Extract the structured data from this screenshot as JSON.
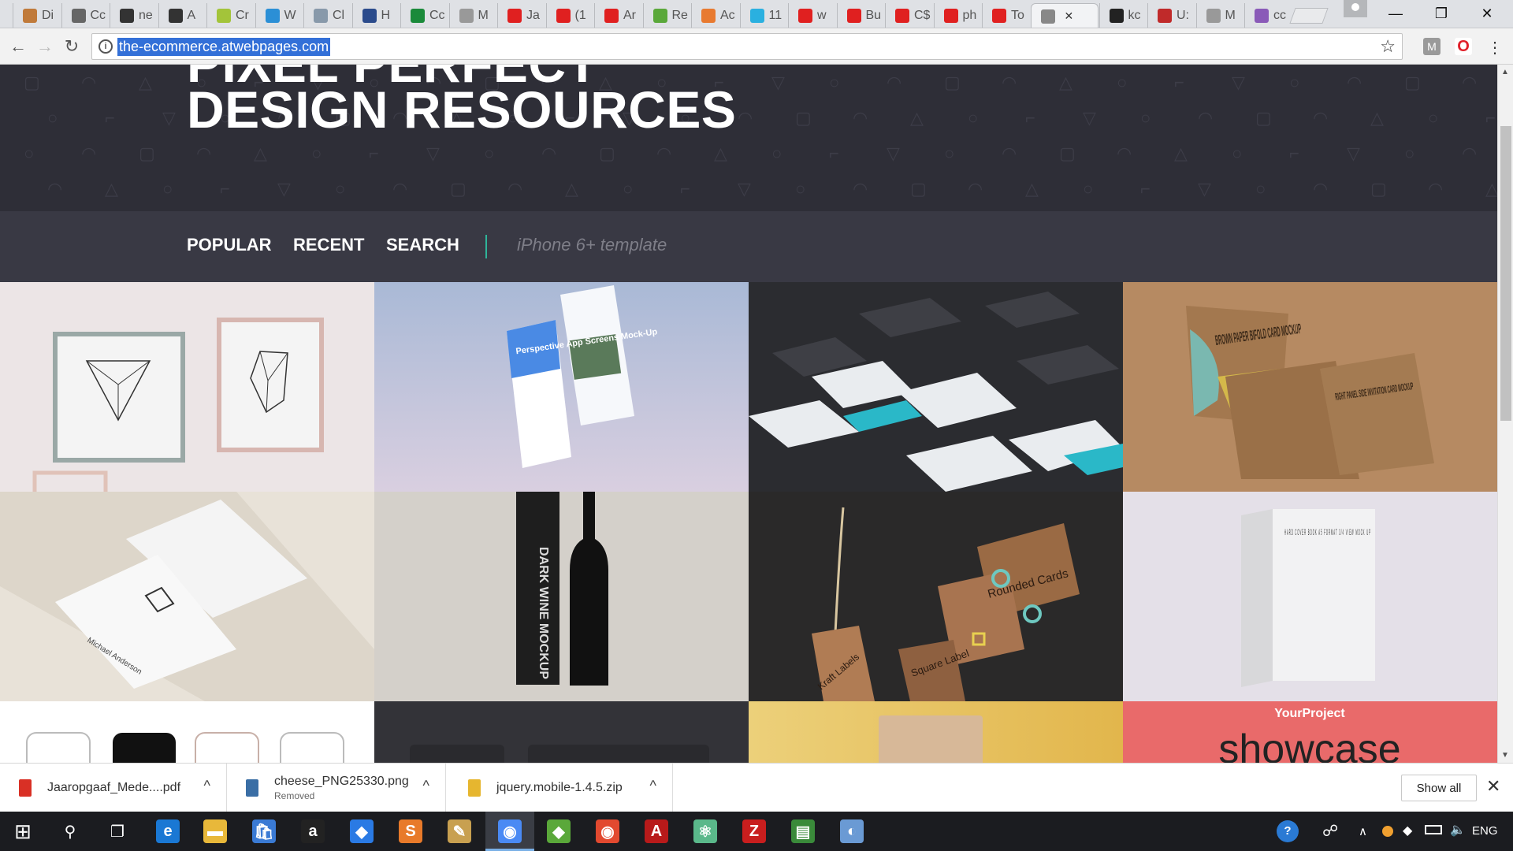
{
  "browser": {
    "tabs": [
      {
        "label": "Di",
        "color": "#c07a3a"
      },
      {
        "label": "Cc",
        "color": "#666666"
      },
      {
        "label": "ne",
        "color": "#333333"
      },
      {
        "label": "A",
        "color": "#333333"
      },
      {
        "label": "Cr",
        "color": "#a3c43a"
      },
      {
        "label": "W",
        "color": "#2b8fd6"
      },
      {
        "label": "Cl",
        "color": "#8899aa"
      },
      {
        "label": "H",
        "color": "#2b4b8c"
      },
      {
        "label": "Cc",
        "color": "#1a8a3a"
      },
      {
        "label": "M",
        "color": "#999999"
      },
      {
        "label": "Ja",
        "color": "#e02020"
      },
      {
        "label": "(1",
        "color": "#e02020"
      },
      {
        "label": "Ar",
        "color": "#e02020"
      },
      {
        "label": "Re",
        "color": "#5aa83a"
      },
      {
        "label": "Ac",
        "color": "#e87a30"
      },
      {
        "label": "11",
        "color": "#2ab0e0"
      },
      {
        "label": "w",
        "color": "#e02020"
      },
      {
        "label": "Bu",
        "color": "#e02020"
      },
      {
        "label": "C$",
        "color": "#e02020"
      },
      {
        "label": "ph",
        "color": "#e02020"
      },
      {
        "label": "To",
        "color": "#e02020"
      },
      {
        "label": "",
        "color": "#888888",
        "active": true
      },
      {
        "label": "kc",
        "color": "#222222"
      },
      {
        "label": "U:",
        "color": "#c02a2a"
      },
      {
        "label": "M",
        "color": "#999999"
      },
      {
        "label": "cc",
        "color": "#8a5ab8"
      }
    ],
    "active_tab_close": "✕",
    "window_controls": {
      "minimize": "—",
      "restore": "❐",
      "close": "✕"
    },
    "back": "←",
    "forward": "→",
    "reload": "↻",
    "address": "the-ecommerce.atwebpages.com",
    "info_glyph": "i",
    "star": "☆",
    "extensions": [
      {
        "glyph": "M",
        "color": "#9a9a9a"
      },
      {
        "glyph": "O",
        "color": "#e0202a"
      }
    ],
    "menu": "⋮"
  },
  "page": {
    "hero_line1": "PIXEL PERFECT",
    "hero_line2": "DESIGN RESOURCES",
    "nav": {
      "popular": "POPULAR",
      "recent": "RECENT",
      "search": "SEARCH"
    },
    "search_placeholder": "iPhone 6+ template",
    "accent": "#2fb59a",
    "tiles": [
      {
        "name": "frames-geometric-mockup",
        "bg": "#ece5e6"
      },
      {
        "name": "perspective-app-screens-mockup",
        "bg": "#bfc6dc",
        "text": "Perspective App Screens Mock-Up"
      },
      {
        "name": "dark-ui-screens-mockup",
        "bg": "#2c2d30"
      },
      {
        "name": "brown-paper-bifold-card-mockup",
        "bg": "#b78e66",
        "text": "BROWN PAPER BIFOLD CARD MOCKUP",
        "text2": "RIGHT PANEL SIDE INVITATION CARD MOCKUP"
      },
      {
        "name": "business-cards-mockup",
        "bg": "#e9e4dc",
        "text": "Michael Anderson"
      },
      {
        "name": "dark-wine-mockup",
        "bg": "#d6d2cc",
        "text": "DARK WINE MOCKUP"
      },
      {
        "name": "kraft-labels-mockup",
        "bg": "#2b2a2a",
        "text": "Rounded Cards",
        "text2": "Square Label",
        "text3": "Kraft Labels"
      },
      {
        "name": "hard-cover-book-mockup",
        "bg": "#e6e3e9",
        "text": "HARD COVER BOOK A5 FORMAT 3/4 VIEW MOCK UP"
      },
      {
        "name": "iphone-wireframes",
        "bg": "#ffffff"
      },
      {
        "name": "dark-devices-mockup",
        "bg": "#333338"
      },
      {
        "name": "pouch-mockup",
        "bg": "#e6c66e"
      },
      {
        "name": "your-project-showcase",
        "bg": "#e86868",
        "text": "YourProject",
        "text2": "showcase"
      }
    ]
  },
  "downloads": [
    {
      "name": "Jaaropgaaf_Mede....pdf",
      "status": "",
      "color": "#d93025"
    },
    {
      "name": "cheese_PNG25330.png",
      "status": "Removed",
      "color": "#3a6ea5"
    },
    {
      "name": "jquery.mobile-1.4.5.zip",
      "status": "",
      "color": "#e6b62f"
    }
  ],
  "download_caret": "^",
  "show_all": "Show all",
  "download_close": "✕",
  "taskbar": {
    "start": "⊞",
    "search": "⚲",
    "taskview": "❐",
    "apps": [
      {
        "name": "edge",
        "glyph": "e",
        "color": "#1a78d4"
      },
      {
        "name": "file-explorer",
        "glyph": "▬",
        "color": "#e8b83a"
      },
      {
        "name": "store",
        "glyph": "🛍",
        "color": "#3a7ad4"
      },
      {
        "name": "amazon",
        "glyph": "a",
        "color": "#222222"
      },
      {
        "name": "dropbox",
        "glyph": "◆",
        "color": "#2a7ae4"
      },
      {
        "name": "sublime",
        "glyph": "S",
        "color": "#e87a2a"
      },
      {
        "name": "paint",
        "glyph": "✎",
        "color": "#c8a050"
      },
      {
        "name": "chrome-active",
        "glyph": "◉",
        "color": "#4a8af4"
      },
      {
        "name": "git",
        "glyph": "◆",
        "color": "#5aa83a"
      },
      {
        "name": "chrome",
        "glyph": "◉",
        "color": "#e2492f"
      },
      {
        "name": "acrobat",
        "glyph": "A",
        "color": "#b81a1a"
      },
      {
        "name": "atom",
        "glyph": "⚛",
        "color": "#5ab88a"
      },
      {
        "name": "filezilla",
        "glyph": "Z",
        "color": "#c81e1e"
      },
      {
        "name": "excel-doc",
        "glyph": "▤",
        "color": "#3a8a3a"
      },
      {
        "name": "paint-palette",
        "glyph": "◐",
        "color": "#6a9ad4"
      }
    ],
    "tray": {
      "help": "?",
      "people": "☍",
      "chevron": "∧",
      "lang": "ENG"
    }
  }
}
